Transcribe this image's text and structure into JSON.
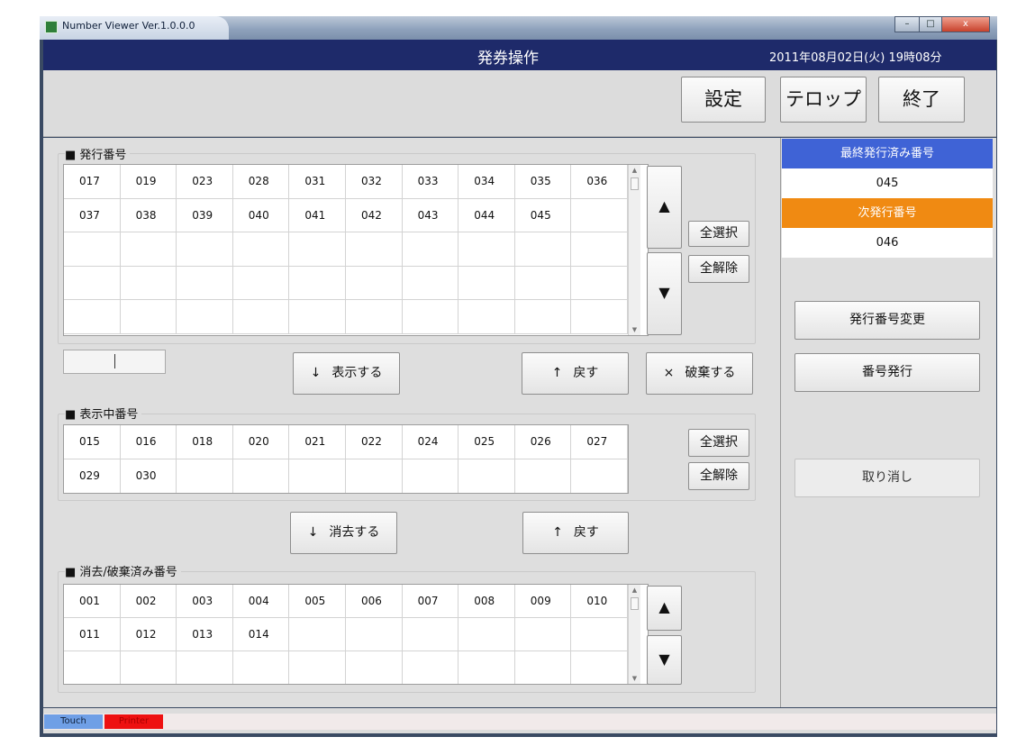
{
  "window": {
    "title": "Number Viewer  Ver.1.0.0.0",
    "controls": {
      "minimize": "–",
      "maximize": "□",
      "close": "x"
    }
  },
  "header": {
    "title": "発券操作",
    "datetime": "2011年08月02日(火) 19時08分"
  },
  "toolbar": {
    "settings": "設定",
    "telop": "テロップ",
    "exit": "終了"
  },
  "issued": {
    "title": "■ 発行番号",
    "numbers": [
      "017",
      "019",
      "023",
      "028",
      "031",
      "032",
      "033",
      "034",
      "035",
      "036",
      "037",
      "038",
      "039",
      "040",
      "041",
      "042",
      "043",
      "044",
      "045"
    ],
    "select_all": "全選択",
    "deselect_all": "全解除",
    "up": "▲",
    "down": "▼"
  },
  "number_input": {
    "value": ""
  },
  "actions_top": {
    "display": "表示する",
    "display_icon": "↓",
    "back": "戻す",
    "back_icon": "↑",
    "discard": "破棄する",
    "discard_icon": "×"
  },
  "displaying": {
    "title": "■ 表示中番号",
    "numbers": [
      "015",
      "016",
      "018",
      "020",
      "021",
      "022",
      "024",
      "025",
      "026",
      "027",
      "029",
      "030"
    ],
    "select_all": "全選択",
    "deselect_all": "全解除"
  },
  "actions_mid": {
    "erase": "消去する",
    "erase_icon": "↓",
    "back": "戻す",
    "back_icon": "↑"
  },
  "erased": {
    "title": "■ 消去/破棄済み番号",
    "numbers": [
      "001",
      "002",
      "003",
      "004",
      "005",
      "006",
      "007",
      "008",
      "009",
      "010",
      "011",
      "012",
      "013",
      "014"
    ],
    "up": "▲",
    "down": "▼"
  },
  "side": {
    "last_issued_label": "最終発行済み番号",
    "last_issued_value": "045",
    "next_label": "次発行番号",
    "next_value": "046",
    "change_button": "発行番号変更",
    "issue_button": "番号発行",
    "cancel_button": "取り消し"
  },
  "status": {
    "touch": "Touch",
    "printer": "Printer"
  },
  "colors": {
    "header_bg": "#1e2a6a",
    "last_issued_bg": "#3f63d6",
    "next_bg": "#f08a12",
    "touch_bg": "#6f9fe6",
    "printer_bg": "#ee1111"
  }
}
